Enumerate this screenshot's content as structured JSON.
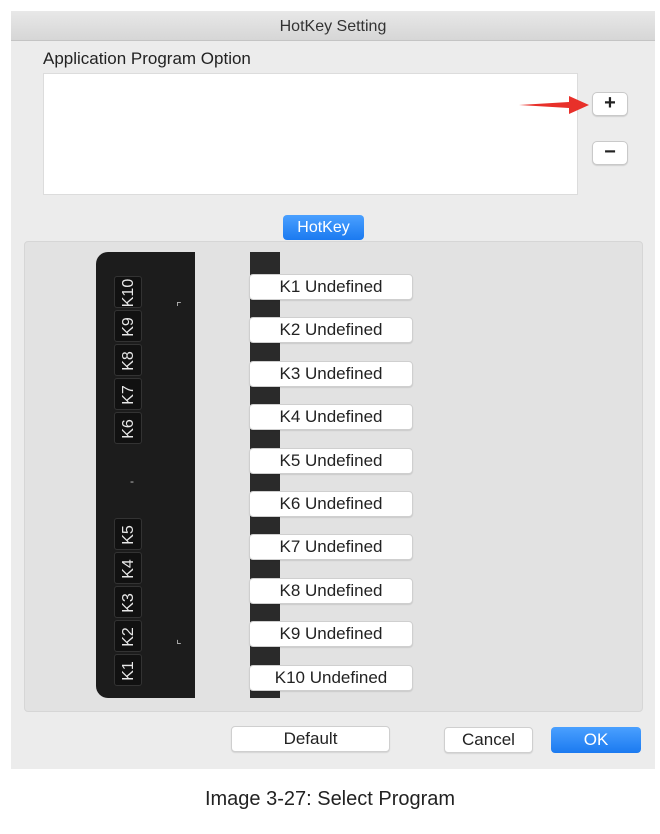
{
  "window": {
    "title": "HotKey Setting"
  },
  "app_section": {
    "label": "Application Program Option",
    "add_label": "+",
    "remove_label": "−"
  },
  "tab": {
    "label": "HotKey"
  },
  "device_keys": [
    "K10",
    "K9",
    "K8",
    "K7",
    "K6",
    "K5",
    "K4",
    "K3",
    "K2",
    "K1"
  ],
  "key_buttons": [
    "K1 Undefined",
    "K2 Undefined",
    "K3 Undefined",
    "K4 Undefined",
    "K5 Undefined",
    "K6 Undefined",
    "K7 Undefined",
    "K8 Undefined",
    "K9 Undefined",
    "K10 Undefined"
  ],
  "footer": {
    "default_label": "Default",
    "cancel_label": "Cancel",
    "ok_label": "OK"
  },
  "caption": "Image 3-27: Select Program",
  "colors": {
    "accent": "#1b7af0",
    "annotation_arrow": "#e8302a",
    "device": "#1c1c1c"
  },
  "icons": {
    "annotation": "red-arrow-icon"
  }
}
